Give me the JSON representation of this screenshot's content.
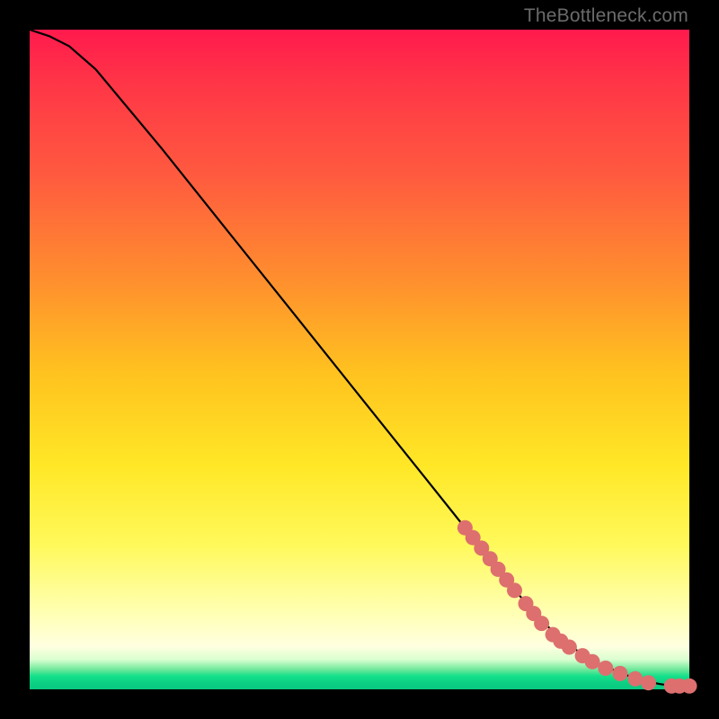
{
  "watermark": "TheBottleneck.com",
  "colors": {
    "black": "#000000",
    "marker": "#dd6f6f",
    "markerStroke": "#c85a5a",
    "line": "#000000"
  },
  "chart_data": {
    "type": "line",
    "title": "",
    "xlabel": "",
    "ylabel": "",
    "xlim": [
      0,
      100
    ],
    "ylim": [
      0,
      100
    ],
    "grid": false,
    "legend": false,
    "series": [
      {
        "name": "curve",
        "x": [
          0,
          3,
          6,
          10,
          20,
          30,
          40,
          50,
          60,
          66,
          70,
          74,
          78,
          82,
          86,
          90,
          93,
          95.5,
          97.5,
          100
        ],
        "y": [
          100,
          99,
          97.5,
          94,
          82,
          69.5,
          57,
          44.5,
          32,
          24.5,
          19.5,
          14.5,
          10,
          6.5,
          4,
          2.3,
          1.3,
          0.8,
          0.5,
          0.5
        ]
      }
    ],
    "markers": [
      {
        "x": 66.0,
        "y": 24.5
      },
      {
        "x": 67.2,
        "y": 23.0
      },
      {
        "x": 68.5,
        "y": 21.4
      },
      {
        "x": 69.8,
        "y": 19.8
      },
      {
        "x": 71.0,
        "y": 18.2
      },
      {
        "x": 72.3,
        "y": 16.6
      },
      {
        "x": 73.5,
        "y": 15.0
      },
      {
        "x": 75.2,
        "y": 13.0
      },
      {
        "x": 76.4,
        "y": 11.5
      },
      {
        "x": 77.6,
        "y": 10.0
      },
      {
        "x": 79.3,
        "y": 8.3
      },
      {
        "x": 80.5,
        "y": 7.3
      },
      {
        "x": 81.8,
        "y": 6.4
      },
      {
        "x": 83.8,
        "y": 5.1
      },
      {
        "x": 85.3,
        "y": 4.2
      },
      {
        "x": 87.3,
        "y": 3.2
      },
      {
        "x": 89.5,
        "y": 2.4
      },
      {
        "x": 91.8,
        "y": 1.6
      },
      {
        "x": 93.8,
        "y": 1.0
      },
      {
        "x": 97.3,
        "y": 0.5
      },
      {
        "x": 98.5,
        "y": 0.5
      },
      {
        "x": 100.0,
        "y": 0.5
      }
    ]
  }
}
